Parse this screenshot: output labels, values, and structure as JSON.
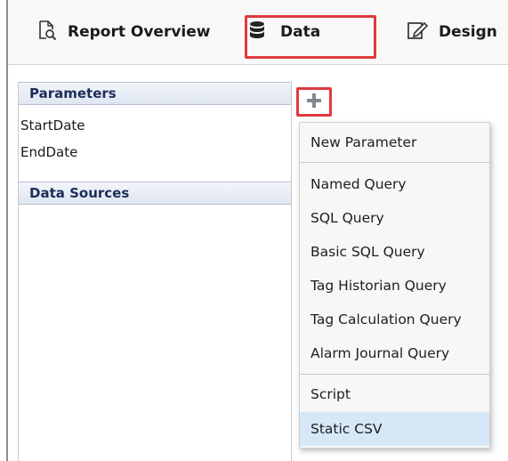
{
  "tabs": [
    {
      "label": "Report Overview",
      "icon": "report-search-icon"
    },
    {
      "label": "Data",
      "icon": "database-icon",
      "active": true
    },
    {
      "label": "Design",
      "icon": "edit-document-icon"
    }
  ],
  "panel": {
    "parameters_header": "Parameters",
    "parameters": [
      "StartDate",
      "EndDate"
    ],
    "data_sources_header": "Data Sources"
  },
  "add_button": {
    "icon": "plus-icon"
  },
  "menu": {
    "items": [
      "New Parameter",
      "Named Query",
      "SQL Query",
      "Basic SQL Query",
      "Tag Historian Query",
      "Tag Calculation Query",
      "Alarm Journal Query",
      "Script",
      "Static CSV"
    ],
    "highlighted": "Static CSV"
  },
  "colors": {
    "highlight_border": "#e0393e",
    "section_header_text": "#1d2d5a",
    "menu_hover": "#d6e8f8",
    "plus_icon": "#7f8a95"
  }
}
